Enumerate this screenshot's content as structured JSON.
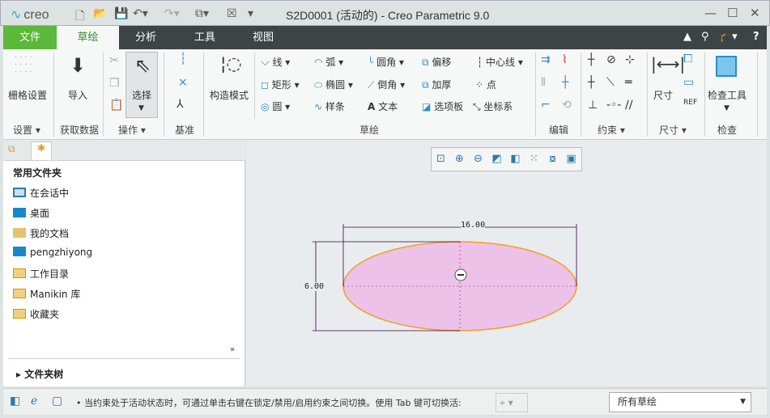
{
  "app": {
    "logo": "creo",
    "title": "S2D0001 (活动的) - Creo Parametric 9.0"
  },
  "tabs": [
    {
      "label": "文件"
    },
    {
      "label": "草绘"
    },
    {
      "label": "分析"
    },
    {
      "label": "工具"
    },
    {
      "label": "视图"
    }
  ],
  "ribbon": {
    "grid_settings": "栅格设置",
    "import": "导入",
    "select": "选择",
    "construction_mode": "构造模式",
    "line": "线",
    "arc": "弧",
    "fillet": "圆角",
    "offset": "偏移",
    "centerline": "中心线",
    "rectangle": "矩形",
    "ellipse": "椭圆",
    "chamfer": "倒角",
    "thicken": "加厚",
    "point": "点",
    "circle": "圆",
    "spline": "样条",
    "text": "文本",
    "palette": "选项板",
    "coord_sys": "坐标系",
    "dimension": "尺寸",
    "inspect_tools": "检查工具",
    "groups": {
      "settings": "设置",
      "get_data": "获取数据",
      "operations": "操作",
      "datum": "基准",
      "sketch": "草绘",
      "edit": "编辑",
      "constrain": "约束",
      "dimension": "尺寸",
      "inspect": "检查"
    }
  },
  "folders": {
    "title": "常用文件夹",
    "items": [
      {
        "label": "在会话中"
      },
      {
        "label": "桌面"
      },
      {
        "label": "我的文档"
      },
      {
        "label": "pengzhiyong"
      },
      {
        "label": "工作目录"
      },
      {
        "label": "Manikin 库"
      },
      {
        "label": "收藏夹"
      }
    ],
    "tree": "文件夹树"
  },
  "sketch": {
    "dim_width": "16.00",
    "dim_height": "6.00",
    "fill": "#ecc2e8",
    "stroke": "#f0a020"
  },
  "status": {
    "message": "• 当约束处于活动状态时，可通过单击右键在锁定/禁用/启用约束之间切换。使用 Tab 键可切换活:",
    "filter": "所有草绘"
  }
}
